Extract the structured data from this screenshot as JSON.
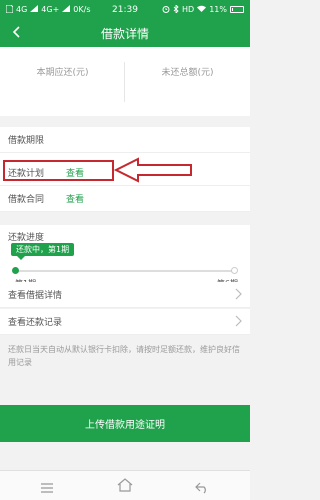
{
  "status_bar": {
    "carrier_1": "4G",
    "carrier_2": "4G+",
    "speed": "0K/s",
    "time": "21:39",
    "network": "HD",
    "battery": "11%"
  },
  "nav": {
    "title": "借款详情"
  },
  "summary": {
    "current_due_label": "本期应还(元)",
    "outstanding_total_label": "未还总额(元)"
  },
  "details": {
    "term_label": "借款期限",
    "plan_label": "还款计划",
    "plan_link": "查看",
    "contract_label": "借款合同",
    "contract_link": "查看"
  },
  "progress": {
    "title": "还款进度",
    "status_badge": "还款中，第1期",
    "start_period": "第1期",
    "end_period": "第6期",
    "current_period": 1,
    "total_periods": 6
  },
  "links": {
    "loan_info": "查看借据详情",
    "repayment_records": "查看还款记录"
  },
  "note": "还款日当天自动从默认银行卡扣除，请按时足额还款，维护良好信用记录",
  "cta": {
    "label": "上传借款用途证明"
  },
  "colors": {
    "brand": "#1fa24b",
    "annotation": "#c6282f"
  }
}
